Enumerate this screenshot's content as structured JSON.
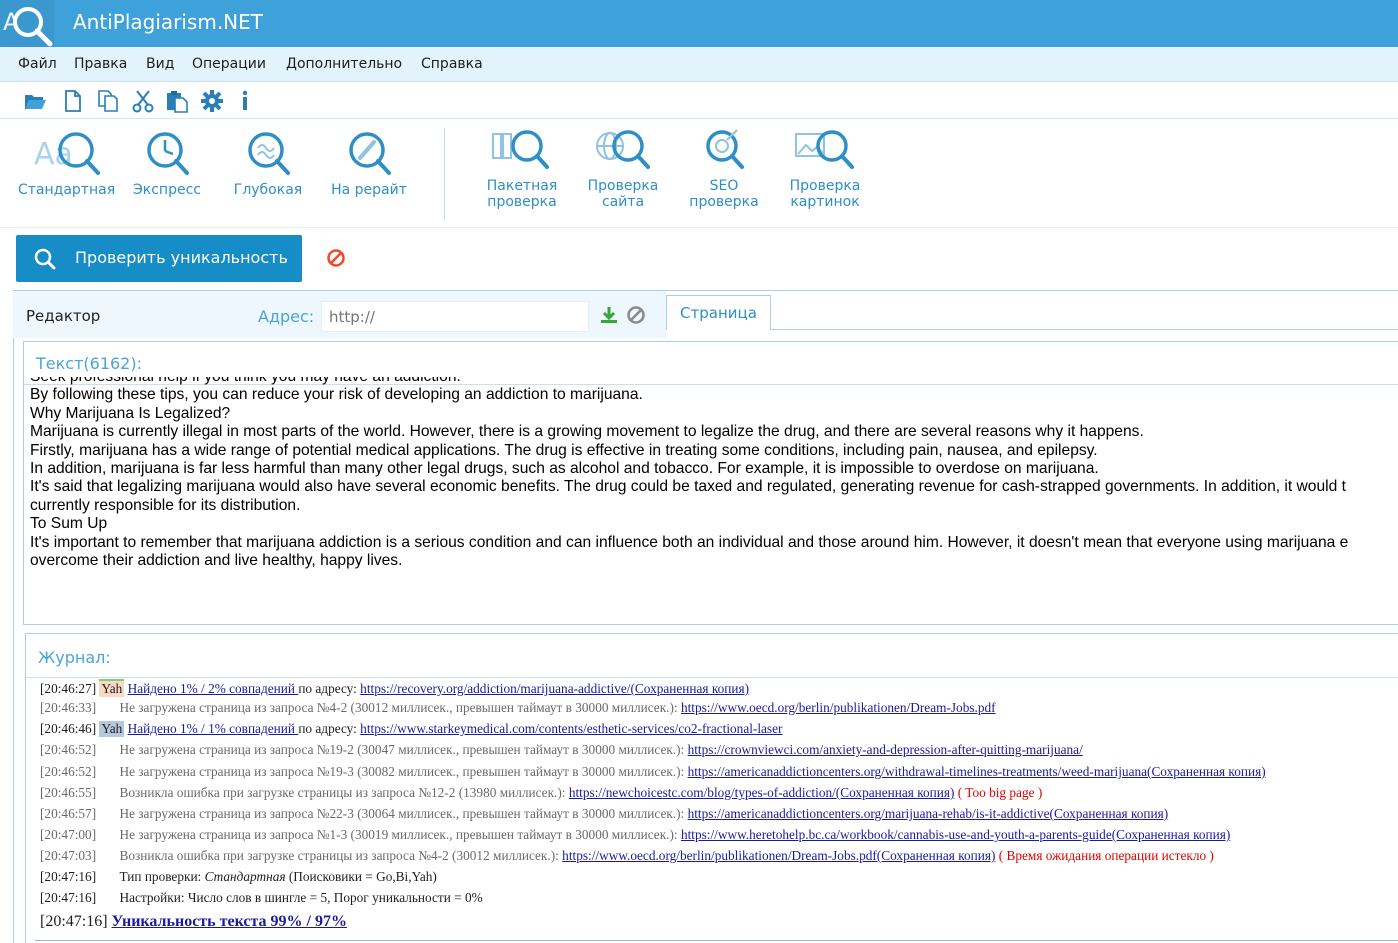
{
  "app": {
    "title": "AntiPlagiarism.NET"
  },
  "menu": [
    "Файл",
    "Правка",
    "Вид",
    "Операции",
    "Дополнительно",
    "Справка"
  ],
  "toolbar_icons": [
    "open-folder-icon",
    "new-file-icon",
    "copy-icon",
    "cut-icon",
    "paste-icon",
    "settings-gear-icon",
    "info-icon"
  ],
  "check_types": [
    {
      "label": "Стандартная",
      "icon": "standard-check-icon"
    },
    {
      "label": "Экспресс",
      "icon": "express-check-icon"
    },
    {
      "label": "Глубокая",
      "icon": "deep-check-icon"
    },
    {
      "label": "На рерайт",
      "icon": "rewrite-check-icon"
    }
  ],
  "extra_checks": [
    {
      "line1": "Пакетная",
      "line2": "проверка",
      "icon": "batch-check-icon"
    },
    {
      "line1": "Проверка",
      "line2": "сайта",
      "icon": "site-check-icon"
    },
    {
      "line1": "SEO",
      "line2": "проверка",
      "icon": "seo-check-icon"
    },
    {
      "line1": "Проверка",
      "line2": "картинок",
      "icon": "image-check-icon"
    }
  ],
  "check_button": {
    "label": "Проверить уникальность"
  },
  "editor": {
    "tab_label": "Редактор",
    "address_label": "Адрес:",
    "address_placeholder": "http://",
    "page_tab": "Страница"
  },
  "text_section": {
    "header": "Текст(6162):",
    "lines": [
      "Seek professional help if you think you may have an addiction.",
      "By following these tips, you can reduce your risk of developing an addiction to marijuana.",
      "Why Marijuana Is Legalized?",
      "Marijuana is currently illegal in most parts of the world. However, there is a growing movement to legalize the drug, and there are several reasons why it happens.",
      "Firstly, marijuana has a wide range of potential medical applications. The drug is effective in treating some conditions, including pain, nausea, and epilepsy.",
      "In addition, marijuana is far less harmful than many other legal drugs, such as alcohol and tobacco. For example, it is impossible to overdose on marijuana.",
      "It's said that legalizing marijuana would also have several economic benefits. The drug could be taxed and regulated, generating revenue for cash-strapped governments. In addition, it would t",
      "currently responsible for its distribution.",
      "To Sum Up",
      "It's important to remember that marijuana addiction is a serious condition and can influence both an individual and those around him. However, it doesn't mean that everyone using marijuana e",
      "overcome their addiction and live healthy, happy lives."
    ]
  },
  "journal": {
    "header": "Журнал:",
    "rows": [
      {
        "time": "[20:46:27]",
        "tag": "Yah",
        "tag_style": "orange",
        "link1": "Найдено 1% / 2% совпадений ",
        "mid": "по адресу: ",
        "link2": "https://recovery.org/addiction/marijuana-addictive/(Сохраненная копия)",
        "err": ""
      },
      {
        "time": "[20:46:33]",
        "grey": true,
        "msg": "Не загружена страница из запроса №4-2 (30012 миллисек., превышен таймаут в 30000 миллисек.): ",
        "link2": "https://www.oecd.org/berlin/publikationen/Dream-Jobs.pdf",
        "err": ""
      },
      {
        "time": "[20:46:46]",
        "tag": "Yah",
        "tag_style": "blue",
        "link1": "Найдено 1% / 1% совпадений ",
        "mid": "по адресу: ",
        "link2": "https://www.starkeymedical.com/contents/esthetic-services/co2-fractional-laser",
        "err": ""
      },
      {
        "time": "[20:46:52]",
        "grey": true,
        "msg": "Не загружена страница из запроса №19-2 (30047 миллисек., превышен таймаут в 30000 миллисек.): ",
        "link2": "https://crownviewci.com/anxiety-and-depression-after-quitting-marijuana/",
        "err": ""
      },
      {
        "time": "[20:46:52]",
        "grey": true,
        "msg": "Не загружена страница из запроса №19-3 (30082 миллисек., превышен таймаут в 30000 миллисек.): ",
        "link2": "https://americanaddictioncenters.org/withdrawal-timelines-treatments/weed-marijuana(Сохраненная копия)",
        "err": ""
      },
      {
        "time": "[20:46:55]",
        "grey": true,
        "msg": "Возникла ошибка при загрузке страницы из запроса №12-2 (13980 миллисек.): ",
        "link2": "https://newchoicestc.com/blog/types-of-addiction/(Сохраненная копия)",
        "err": " ( Too big page )"
      },
      {
        "time": "[20:46:57]",
        "grey": true,
        "msg": "Не загружена страница из запроса №22-3 (30064 миллисек., превышен таймаут в 30000 миллисек.): ",
        "link2": "https://americanaddictioncenters.org/marijuana-rehab/is-it-addictive(Сохраненная копия)",
        "err": ""
      },
      {
        "time": "[20:47:00]",
        "grey": true,
        "msg": "Не загружена страница из запроса №1-3 (30019 миллисек., превышен таймаут в 30000 миллисек.): ",
        "link2": "https://www.heretohelp.bc.ca/workbook/cannabis-use-and-youth-a-parents-guide(Сохраненная копия)",
        "err": ""
      },
      {
        "time": "[20:47:03]",
        "grey": true,
        "msg": "Возникла ошибка при загрузке страницы из запроса №4-2 (30012 миллисек.): ",
        "link2": "https://www.oecd.org/berlin/publikationen/Dream-Jobs.pdf(Сохраненная копия)",
        "err": " ( Время ожидания операции истекло )"
      },
      {
        "time": "[20:47:16]",
        "msg_dark": "Тип проверки: ",
        "italic": "Стандартная",
        "msg_dark2": " (Поисковики = Go,Bi,Yah)"
      },
      {
        "time": "[20:47:16]",
        "msg_dark": "Настройки: Число слов в шингле = 5, Порог уникальности = 0%"
      }
    ],
    "final_time": "[20:47:16]",
    "final_result": "Уникальность текста 99% / 97%"
  },
  "colors": {
    "titlebar": "#3fa1da",
    "accent": "#168dc7",
    "icon_blue": "#2d8fc6",
    "link": "#1a1a9e",
    "error": "#e00000"
  }
}
